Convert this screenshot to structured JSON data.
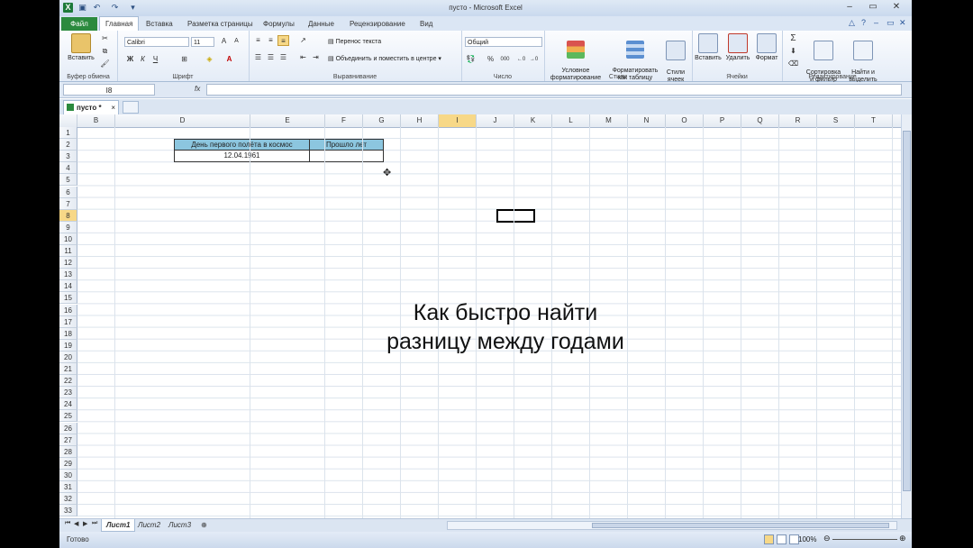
{
  "window": {
    "title": "пусто  -  Microsoft Excel",
    "app_icon": "X"
  },
  "tabs": {
    "file": "Файл",
    "items": [
      "Главная",
      "Вставка",
      "Разметка страницы",
      "Формулы",
      "Данные",
      "Рецензирование",
      "Вид"
    ]
  },
  "ribbon": {
    "clipboard": {
      "paste": "Вставить",
      "label": "Буфер обмена"
    },
    "font": {
      "name": "Calibri",
      "size": "11",
      "bold": "Ж",
      "italic": "К",
      "underline": "Ч",
      "label": "Шрифт"
    },
    "alignment": {
      "wrap": "Перенос текста",
      "merge": "Объединить и поместить в центре",
      "label": "Выравнивание"
    },
    "number": {
      "format": "Общий",
      "percent": "%",
      "thousands": "000",
      "label": "Число"
    },
    "styles": {
      "conditional": "Условное\nформатирование",
      "table": "Форматировать\nкак таблицу",
      "cell": "Стили\nячеек",
      "label": "Стили"
    },
    "cells": {
      "insert": "Вставить",
      "delete": "Удалить",
      "format": "Формат",
      "label": "Ячейки"
    },
    "editing": {
      "sum": "Σ",
      "sort": "Сортировка\nи фильтр",
      "find": "Найти и\nвыделить",
      "label": "Редактирование"
    }
  },
  "formula_bar": {
    "name_box": "I8",
    "fx": "fx",
    "value": ""
  },
  "workbook_tab": {
    "name": "пусто *",
    "close": "×"
  },
  "columns": [
    "B",
    "D",
    "E",
    "F",
    "G",
    "H",
    "I",
    "J",
    "K",
    "L",
    "M",
    "N",
    "O",
    "P",
    "Q",
    "R",
    "S",
    "T"
  ],
  "rows": [
    "1",
    "2",
    "3",
    "4",
    "5",
    "6",
    "7",
    "8",
    "9",
    "10",
    "11",
    "12",
    "13",
    "14",
    "15",
    "16",
    "17",
    "18",
    "19",
    "20",
    "21",
    "22",
    "23",
    "24",
    "25",
    "26",
    "27",
    "28",
    "29",
    "30",
    "31",
    "32",
    "33"
  ],
  "table": {
    "header_d": "День первого полёта в космос",
    "header_e": "Прошло лет",
    "d3": "12.04.1961",
    "e3": ""
  },
  "selected_cell": "I8",
  "caption": {
    "line1": "Как быстро найти",
    "line2": "разницу между годами"
  },
  "sheets": [
    "Лист1",
    "Лист2",
    "Лист3"
  ],
  "status": {
    "text": "Готово",
    "zoom": "100%"
  },
  "colors": {
    "header_fill": "#8cc6df",
    "file_tab": "#2b8a3e",
    "selection_header": "#f7d887"
  }
}
